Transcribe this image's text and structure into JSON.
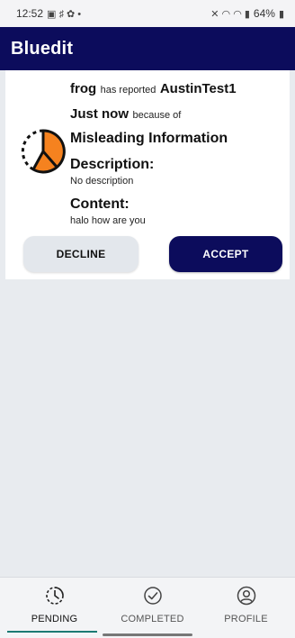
{
  "status_bar": {
    "time": "12:52",
    "battery": "64%"
  },
  "app": {
    "title": "Bluedit"
  },
  "report": {
    "reporter": "frog",
    "has_reported_text": "has reported",
    "reported_user": "AustinTest1",
    "time_ago": "Just now",
    "because_of_text": "because of",
    "reason": "Misleading Information",
    "description_heading": "Description:",
    "description": "No description",
    "content_heading": "Content:",
    "content": "halo how are you"
  },
  "actions": {
    "decline_label": "DECLINE",
    "accept_label": "ACCEPT"
  },
  "bottom_nav": {
    "items": [
      {
        "label": "PENDING",
        "icon": "pending-clock-icon",
        "active": true
      },
      {
        "label": "COMPLETED",
        "icon": "check-circle-icon",
        "active": false
      },
      {
        "label": "PROFILE",
        "icon": "profile-icon",
        "active": false
      }
    ]
  },
  "colors": {
    "primary": "#0c0c5c",
    "clock_fill": "#f5821f",
    "nav_indicator": "#1b7a73",
    "background": "#e8ebef"
  }
}
